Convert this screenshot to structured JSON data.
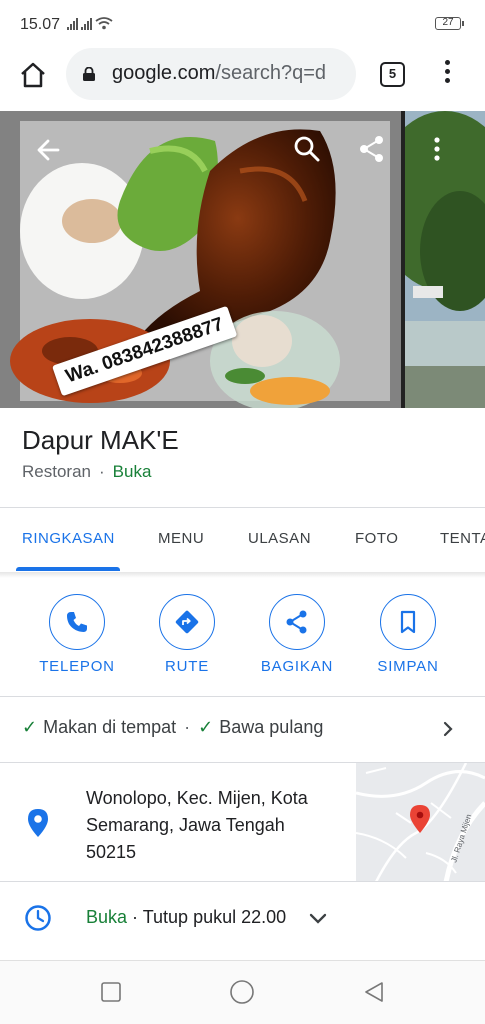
{
  "status_bar": {
    "time": "15.07",
    "battery": "27"
  },
  "browser": {
    "home_icon": "home-icon",
    "url_host": "google.com",
    "url_path": "/search?q=d",
    "tab_count": "5"
  },
  "hero": {
    "whatsapp_overlay": "Wa. 083842388877",
    "icons": [
      "back-arrow-icon",
      "search-icon",
      "share-icon",
      "more-vert-icon"
    ]
  },
  "place": {
    "name": "Dapur MAK'E",
    "category": "Restoran",
    "separator": "·",
    "status": "Buka"
  },
  "tabs": [
    {
      "label": "RINGKASAN",
      "active": true
    },
    {
      "label": "MENU",
      "active": false
    },
    {
      "label": "ULASAN",
      "active": false
    },
    {
      "label": "FOTO",
      "active": false
    },
    {
      "label": "TENTANG",
      "active": false
    }
  ],
  "actions": [
    {
      "label": "TELEPON",
      "icon": "phone-icon"
    },
    {
      "label": "RUTE",
      "icon": "directions-icon"
    },
    {
      "label": "BAGIKAN",
      "icon": "share-icon"
    },
    {
      "label": "SIMPAN",
      "icon": "bookmark-icon"
    }
  ],
  "service_options": {
    "check": "✓",
    "dine_in": "Makan di tempat",
    "separator": "·",
    "takeaway": "Bawa pulang"
  },
  "address": {
    "text": "Wonolopo, Kec. Mijen, Kota Semarang, Jawa Tengah 50215",
    "map_road_label": "Jl. Raya Mijen"
  },
  "hours": {
    "status": "Buka",
    "separator": " · ",
    "closing": "Tutup pukul 22.00"
  },
  "colors": {
    "accent_blue": "#1a73e8",
    "open_green": "#188038",
    "map_pin_red": "#ea4335"
  }
}
